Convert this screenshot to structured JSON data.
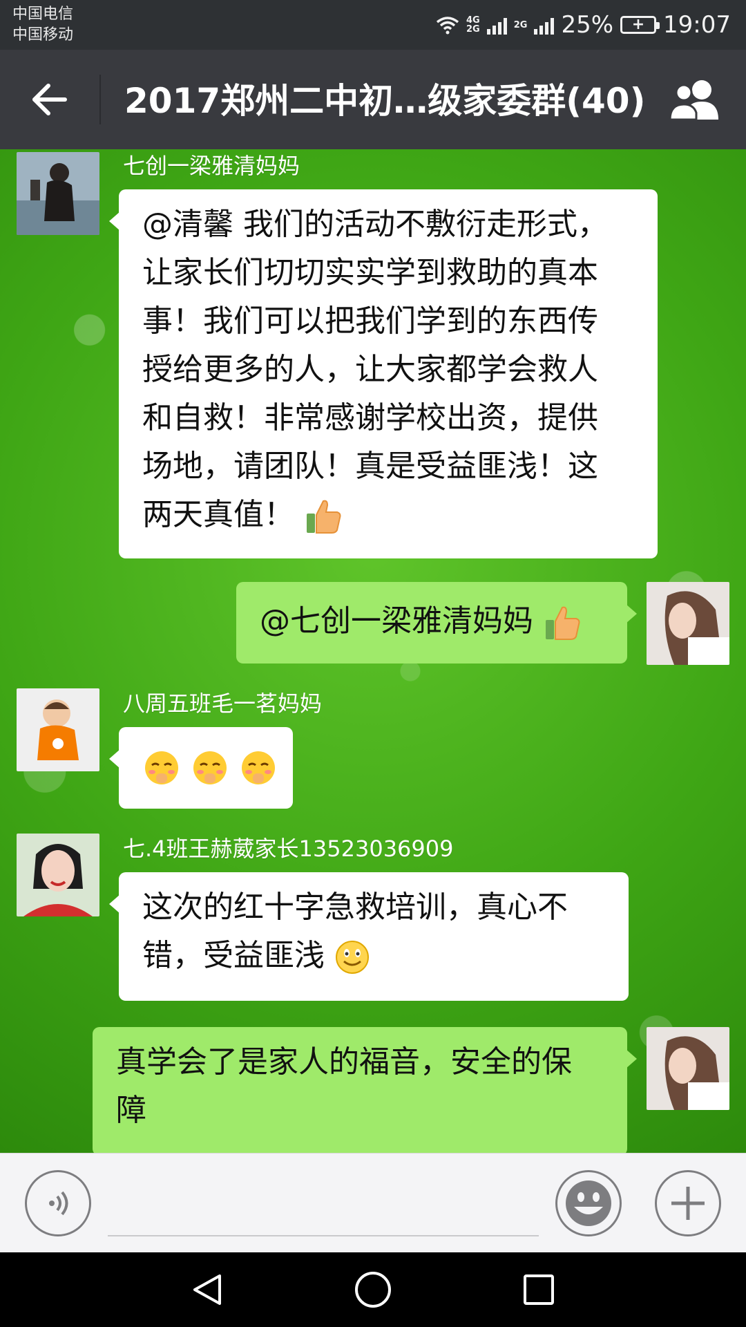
{
  "status_bar": {
    "carrier_1": "中国电信",
    "carrier_2": "中国移动",
    "net_top": "4G",
    "net_bottom": "2G",
    "net_2": "2G",
    "battery": "25%",
    "time": "19:07"
  },
  "header": {
    "title": "2017郑州二中初…级家委群(40)",
    "back_icon": "arrow-left-icon",
    "group_icon": "group-members-icon"
  },
  "messages": [
    {
      "direction": "in",
      "sender": "七创一梁雅清妈妈",
      "lines": [
        "@清馨 我们的活动不敷衍走形式，",
        "让家长们切切实实学到救助的真本",
        "事！我们可以把我们学到的东西传",
        "授给更多的人，让大家都学会救人",
        "和自救！非常感谢学校出资，提供",
        "场地，请团队！真是受益匪浅！这",
        "两天真值！"
      ],
      "trailing_emoji": "thumbs-up"
    },
    {
      "direction": "out",
      "text": "@七创一梁雅清妈妈",
      "trailing_emoji": "thumbs-up"
    },
    {
      "direction": "in",
      "sender": "八周五班毛一茗妈妈",
      "emojis": [
        "blush-hand-emoji",
        "blush-hand-emoji",
        "blush-hand-emoji"
      ]
    },
    {
      "direction": "in",
      "sender": "七.4班王赫葳家长13523036909",
      "lines": [
        "这次的红十字急救培训，真心不",
        "错，受益匪浅"
      ],
      "trailing_emoji": "smile"
    },
    {
      "direction": "out",
      "lines": [
        "真学会了是家人的福音，安全的保",
        "障"
      ]
    }
  ],
  "colors": {
    "status_bar": "#2e3134",
    "title_bar": "#393a3f",
    "incoming_bubble": "#ffffff",
    "outgoing_bubble": "#9fea6a",
    "wallpaper": "#3fa615"
  }
}
